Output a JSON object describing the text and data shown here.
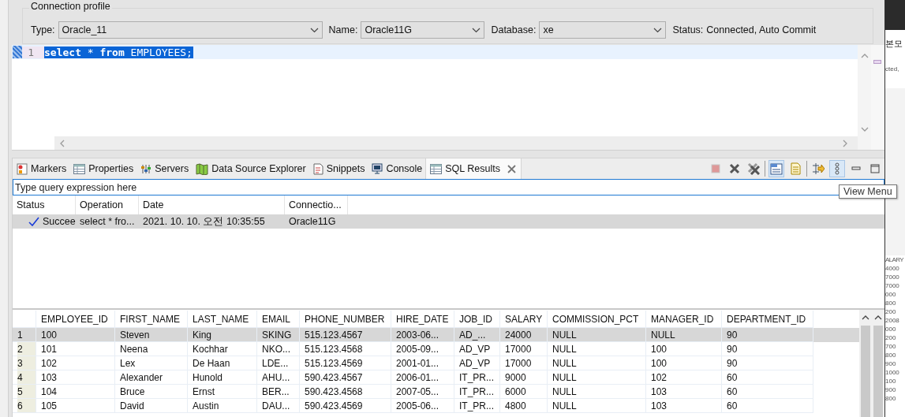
{
  "connection_profile": {
    "title": "Connection profile",
    "fields": [
      {
        "label": "Type:",
        "value": "Oracle_11",
        "kind": "combo"
      },
      {
        "label": "Name:",
        "value": "Oracle11G",
        "kind": "combo"
      },
      {
        "label": "Database:",
        "value": "xe",
        "kind": "combo"
      },
      {
        "label": "Status:",
        "value": "Connected, Auto Commit",
        "kind": "text"
      }
    ]
  },
  "editor": {
    "lines": [
      {
        "number": "1",
        "text": "**select** * **from** EMPLOYEES;",
        "selected": true
      }
    ]
  },
  "view_tabs": [
    {
      "label": "Markers",
      "kind": "markers",
      "selected": false,
      "closable": false
    },
    {
      "label": "Properties",
      "kind": "properties",
      "selected": false,
      "closable": false
    },
    {
      "label": "Servers",
      "kind": "servers",
      "selected": false,
      "closable": false
    },
    {
      "label": "Data Source Explorer",
      "kind": "datasource",
      "selected": false,
      "closable": false
    },
    {
      "label": "Snippets",
      "kind": "snippets",
      "selected": false,
      "closable": false
    },
    {
      "label": "Console",
      "kind": "console",
      "selected": false,
      "closable": false
    },
    {
      "label": "SQL Results",
      "kind": "results",
      "selected": true,
      "closable": true
    }
  ],
  "toolbar_groups": [
    [
      {
        "kind": "stop",
        "selected": false,
        "disabled": true
      },
      {
        "kind": "remove",
        "selected": false,
        "disabled": false
      },
      {
        "kind": "remove_all",
        "selected": false,
        "disabled": false
      }
    ],
    [
      {
        "kind": "layout",
        "selected": true,
        "disabled": false
      },
      {
        "kind": "text_mode",
        "selected": false,
        "disabled": false
      }
    ],
    [
      {
        "kind": "arrows",
        "selected": false,
        "disabled": false
      },
      {
        "kind": "view_menu",
        "selected": true,
        "disabled": false
      },
      {
        "kind": "minimize",
        "selected": false,
        "disabled": false
      },
      {
        "kind": "maximize",
        "selected": false,
        "disabled": false
      }
    ]
  ],
  "tooltip": "View Menu",
  "filter": {
    "placeholder": "Type query expression here"
  },
  "history": {
    "columns": [
      "Status",
      "Operation",
      "Date",
      "Connectio..."
    ],
    "rows": [
      {
        "status": "Succee",
        "operation": "select * fro...",
        "date": "2021. 10. 10. 오전 10:35:55",
        "connection": "Oracle11G",
        "succeeded": true,
        "selected": true
      }
    ]
  },
  "result_grid": {
    "columns": [
      "",
      "EMPLOYEE_ID",
      "FIRST_NAME",
      "LAST_NAME",
      "EMAIL",
      "PHONE_NUMBER",
      "HIRE_DATE",
      "JOB_ID",
      "SALARY",
      "COMMISSION_PCT",
      "MANAGER_ID",
      "DEPARTMENT_ID"
    ],
    "rows": [
      {
        "selected": true,
        "cells": [
          "1",
          "100",
          "Steven",
          "King",
          "SKING",
          "515.123.4567",
          "2003-06...",
          "AD_...",
          "24000",
          "NULL",
          "NULL",
          "90"
        ]
      },
      {
        "selected": false,
        "cells": [
          "2",
          "101",
          "Neena",
          "Kochhar",
          "NKO...",
          "515.123.4568",
          "2005-09...",
          "AD_VP",
          "17000",
          "NULL",
          "100",
          "90"
        ]
      },
      {
        "selected": false,
        "cells": [
          "3",
          "102",
          "Lex",
          "De Haan",
          "LDE...",
          "515.123.4569",
          "2001-01...",
          "AD_VP",
          "17000",
          "NULL",
          "100",
          "90"
        ]
      },
      {
        "selected": false,
        "cells": [
          "4",
          "103",
          "Alexander",
          "Hunold",
          "AHU...",
          "590.423.4567",
          "2006-01...",
          "IT_PR...",
          "9000",
          "NULL",
          "102",
          "60"
        ]
      },
      {
        "selected": false,
        "cells": [
          "5",
          "104",
          "Bruce",
          "Ernst",
          "BER...",
          "590.423.4568",
          "2007-05...",
          "IT_PR...",
          "6000",
          "NULL",
          "103",
          "60"
        ]
      },
      {
        "selected": false,
        "cells": [
          "6",
          "105",
          "David",
          "Austin",
          "DAU...",
          "590.423.4569",
          "2005-06...",
          "IT_PR...",
          "4800",
          "NULL",
          "103",
          "60"
        ]
      }
    ]
  },
  "background_window": {
    "heading": "본모",
    "status_fragment": "cted,",
    "column_header": "ALARY",
    "values": [
      "4000",
      "7000",
      "7000",
      "000",
      "800",
      "200",
      "2008",
      "000",
      "200",
      "700",
      "800",
      "900",
      "1000",
      "100",
      "900",
      "800"
    ]
  }
}
